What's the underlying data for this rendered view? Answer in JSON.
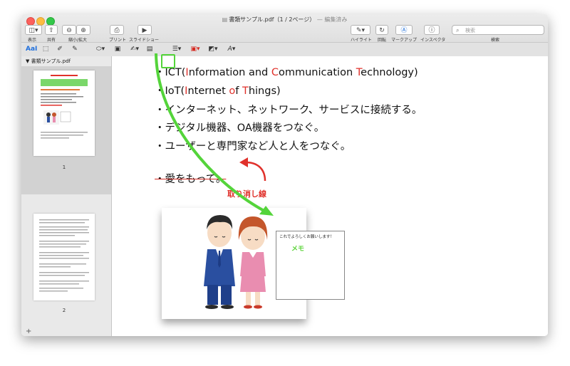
{
  "window": {
    "title": "書類サンプル.pdf（1 / 2ページ）",
    "edited_suffix": "— 編集済み"
  },
  "toolbar": {
    "view_label": "表示",
    "share_label": "共有",
    "zoom_label": "縮小/拡大",
    "print_label": "プリント",
    "slideshow_label": "スライドショー",
    "highlight_label": "ハイライト",
    "rotate_label": "回転",
    "markup_label": "マークアップ",
    "inspector_label": "インスペクタ",
    "search_label": "検索",
    "search_placeholder": "検索"
  },
  "markup": {
    "text_style": "AaI"
  },
  "sidebar": {
    "doc_name": "書類サンプル.pdf",
    "pages": [
      {
        "number": "1"
      },
      {
        "number": "2"
      }
    ]
  },
  "document": {
    "lines": [
      {
        "pre": "・ICT(",
        "parts": [
          [
            "I",
            "r"
          ],
          [
            "nformation and ",
            "n"
          ],
          [
            "C",
            "r"
          ],
          [
            "ommunication ",
            "n"
          ],
          [
            "T",
            "r"
          ],
          [
            "echnology)",
            "n"
          ]
        ]
      },
      {
        "pre": "・IoT(",
        "parts": [
          [
            "I",
            "r"
          ],
          [
            "nternet ",
            "n"
          ],
          [
            "o",
            "r"
          ],
          [
            "f ",
            "n"
          ],
          [
            "T",
            "r"
          ],
          [
            "hings)",
            "n"
          ]
        ]
      },
      {
        "pre": "",
        "parts": [
          [
            "・インターネット、ネットワーク、サービスに接続する。",
            "n"
          ]
        ]
      },
      {
        "pre": "",
        "parts": [
          [
            "・デジタル機器、OA機器をつなぐ。",
            "n"
          ]
        ]
      },
      {
        "pre": "",
        "parts": [
          [
            "・ユーザーと専門家など人と人をつなぐ。",
            "n"
          ]
        ]
      }
    ],
    "struck_line": "・愛をもって。",
    "strike_label": "取り消し線",
    "memo_text": "これでよろしくお願いします！",
    "memo_label": "メモ"
  },
  "colors": {
    "accent_red": "#e0312b",
    "accent_green": "#54d43a"
  }
}
